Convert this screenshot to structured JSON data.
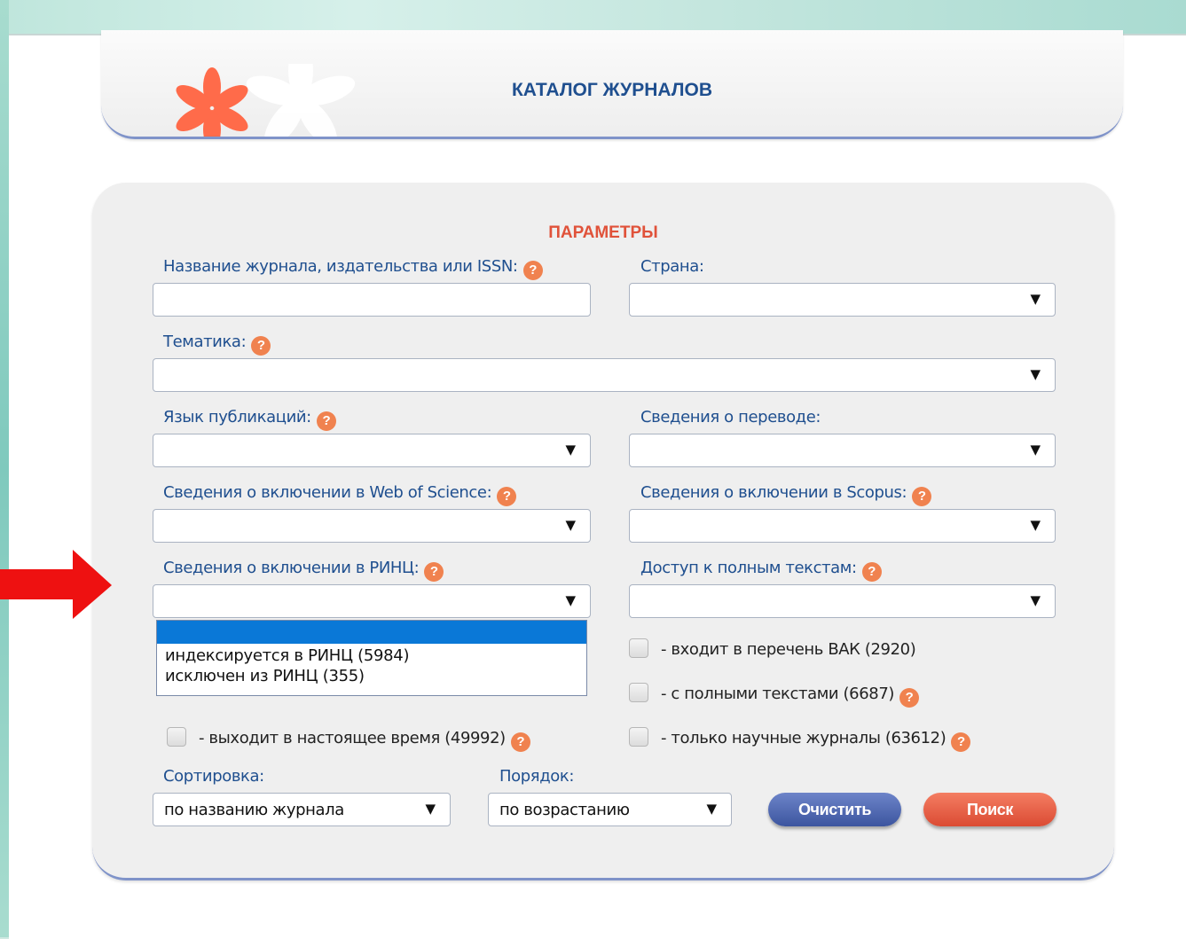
{
  "header": {
    "title": "КАТАЛОГ ЖУРНАЛОВ"
  },
  "panel": {
    "title": "ПАРАМЕТРЫ",
    "help_symbol": "?",
    "fields": {
      "journal_name_label": "Название журнала, издательства или ISSN:",
      "country_label": "Страна:",
      "topic_label": "Тематика:",
      "language_label": "Язык публикаций:",
      "translation_label": "Сведения о переводе:",
      "wos_label": "Сведения о включении в Web of Science:",
      "scopus_label": "Сведения о включении в Scopus:",
      "rinc_label": "Сведения о включении в РИНЦ:",
      "fulltext_access_label": "Доступ к полным текстам:"
    },
    "rinc_dropdown": {
      "selected": "",
      "options": [
        "индексируется в РИНЦ  (5984)",
        "исключен из РИНЦ  (355)"
      ]
    },
    "checkboxes": {
      "vak": "- входит в перечень ВАК (2920)",
      "fulltexts": "- с полными текстами (6687)",
      "current": "- выходит в настоящее время (49992)",
      "scientific": "- только научные журналы (63612)"
    },
    "sort": {
      "label": "Сортировка:",
      "value": "по названию журнала"
    },
    "order": {
      "label": "Порядок:",
      "value": "по возрастанию"
    },
    "buttons": {
      "clear": "Очистить",
      "search": "Поиск"
    }
  },
  "colors": {
    "accent_orange": "#f0824f",
    "label_blue": "#1f4f8f",
    "selected_blue": "#0a78d7"
  }
}
